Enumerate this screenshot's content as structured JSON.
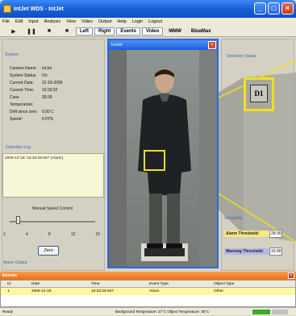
{
  "window": {
    "title": "IntJet WDS - IntJet"
  },
  "menu": [
    "File",
    "Edit",
    "Input",
    "Analysis",
    "View",
    "Video",
    "Output",
    "Help",
    "Login",
    "Logout"
  ],
  "toolbar": {
    "icons": [
      "play-icon",
      "pause-icon",
      "stop-icon"
    ],
    "buttons": [
      "Left",
      "Right",
      "Events",
      "Video",
      "MMW",
      "BlueMax"
    ]
  },
  "system": {
    "title": "System",
    "rows": [
      {
        "k": "Camera Name:",
        "v": "IntJet"
      },
      {
        "k": "System Status:",
        "v": "On"
      },
      {
        "k": "Current Date:",
        "v": "12-18-2006"
      },
      {
        "k": "Current Time:",
        "v": "15:33:32"
      },
      {
        "k": "Case Temperature:",
        "v": "38.00"
      },
      {
        "k": "Drift since zero:",
        "v": "0.00 C"
      },
      {
        "k": "Speed:",
        "v": "6 FPS"
      }
    ]
  },
  "detection_log": {
    "title": "Detection Log",
    "line": "2006-12-18: 15:33:29.937 (Alarm)"
  },
  "speed_control": {
    "title": "Manual Speed Control",
    "ticks": [
      "1",
      "4",
      "8",
      "12",
      "15"
    ],
    "value": 2,
    "zero_label": "Zero"
  },
  "alarm_output": {
    "title": "Alarm Output"
  },
  "video": {
    "title": "IntJet",
    "close": "×"
  },
  "detection_status": {
    "title": "Detection Status",
    "badge": "D1"
  },
  "sensitivity": {
    "title": "Sensitivity",
    "alarm_label": "Alarm Threshold:",
    "alarm_value": "28.00",
    "warning_label": "Warning Threshold:",
    "warning_value": "15.00"
  },
  "events": {
    "title": "Events",
    "columns": [
      "Id",
      "Date",
      "Time",
      "Event Type",
      "Object Type"
    ],
    "rows": [
      [
        "1",
        "2006-12-18",
        "15:33:29.937",
        "Alarm",
        "Other"
      ]
    ]
  },
  "statusbar": {
    "left": "Ready",
    "mid": "Background Temperature: 27°C  Object Temperature: 36°C"
  },
  "colors": {
    "accent": "#1a5fd6",
    "events": "#e8701a",
    "highlight": "#f0e020"
  }
}
